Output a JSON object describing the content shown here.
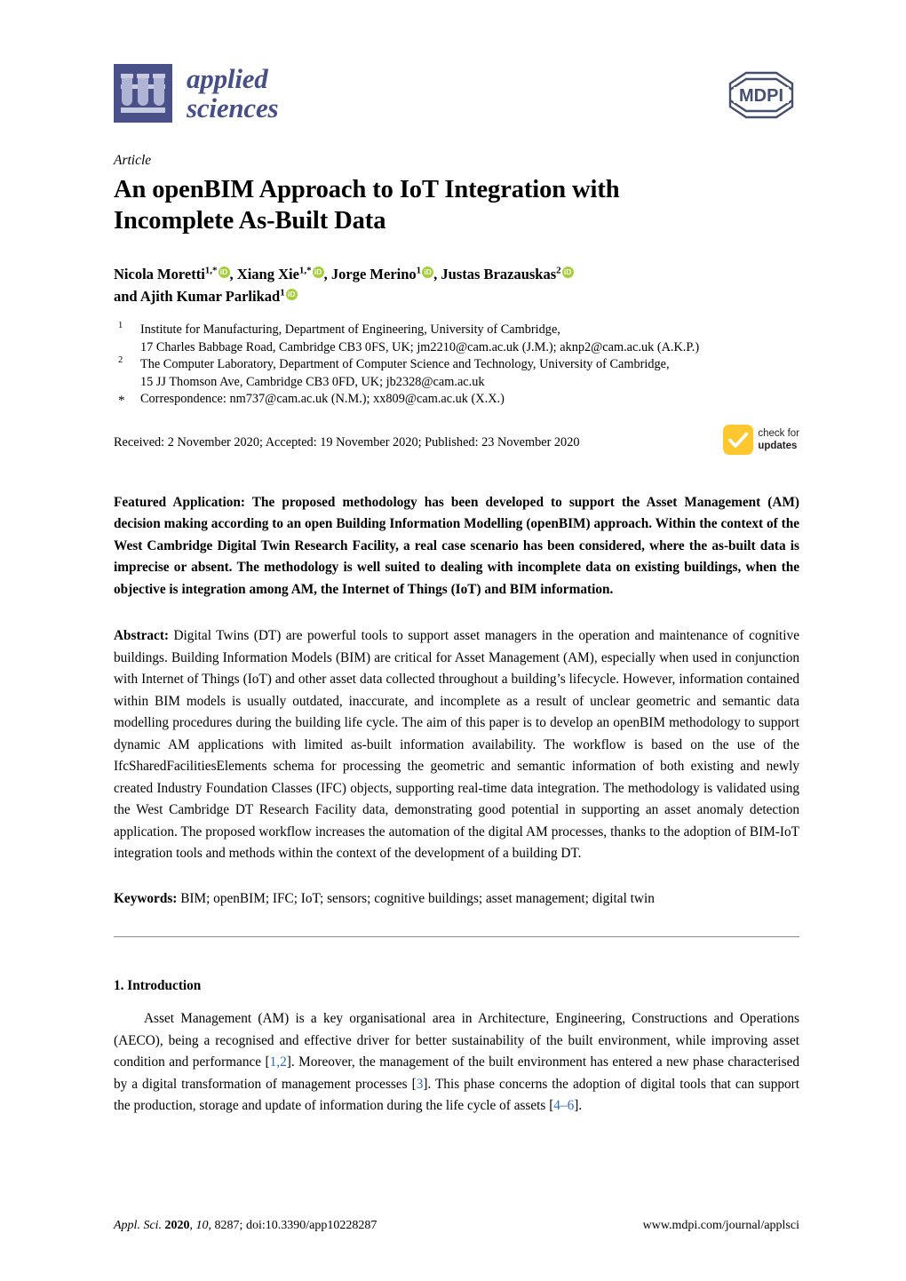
{
  "journal": {
    "name_line1": "applied",
    "name_line2": "sciences",
    "publisher_logo_text": "MDPI",
    "logo_icon": "test-tube-rack-icon",
    "brand_color": "#474f88"
  },
  "article_type": "Article",
  "title_lines": [
    "An openBIM Approach to IoT Integration with",
    "Incomplete As-Built Data"
  ],
  "authors": {
    "line1": [
      {
        "name": "Nicola Moretti",
        "sup": "1,*",
        "orcid": "iD"
      },
      {
        "name": "Xiang Xie",
        "sup": "1,*",
        "orcid": "iD"
      },
      {
        "name": "Jorge Merino",
        "sup": "1",
        "orcid": "iD"
      },
      {
        "name": "Justas Brazauskas",
        "sup": "2",
        "orcid": "iD"
      }
    ],
    "line2_prefix": "and",
    "line2": [
      {
        "name": "Ajith Kumar Parlikad",
        "sup": "1",
        "orcid": "iD"
      }
    ]
  },
  "affiliations": [
    {
      "marker": "1",
      "lines": [
        "Institute for Manufacturing, Department of Engineering, University of Cambridge,",
        "17 Charles Babbage Road, Cambridge CB3 0FS, UK; jm2210@cam.ac.uk (J.M.); aknp2@cam.ac.uk (A.K.P.)"
      ]
    },
    {
      "marker": "2",
      "lines": [
        "The Computer Laboratory, Department of Computer Science and Technology, University of Cambridge,",
        "15 JJ Thomson Ave, Cambridge CB3 0FD, UK; jb2328@cam.ac.uk"
      ]
    },
    {
      "marker": "*",
      "lines": [
        "Correspondence: nm737@cam.ac.uk (N.M.); xx809@cam.ac.uk (X.X.)"
      ]
    }
  ],
  "dates_line": "Received: 2 November 2020; Accepted: 19 November 2020; Published: 23 November 2020",
  "crossmark": {
    "line1": "check for",
    "line2": "updates",
    "icon": "checkmark-icon",
    "color": "#fdc82f"
  },
  "featured_application": {
    "lead": "Featured Application:",
    "text": " The proposed methodology has been developed to support the Asset Management (AM) decision making according to an open Building Information Modelling (openBIM) approach. Within the context of the West Cambridge Digital Twin Research Facility, a real case scenario has been considered, where the as-built data is imprecise or absent. The methodology is well suited to dealing with incomplete data on existing buildings, when the objective is integration among AM, the Internet of Things (IoT) and BIM information."
  },
  "abstract": {
    "lead": "Abstract:",
    "text": " Digital Twins (DT) are powerful tools to support asset managers in the operation and maintenance of cognitive buildings. Building Information Models (BIM) are critical for Asset Management (AM), especially when used in conjunction with Internet of Things (IoT) and other asset data collected throughout a building’s lifecycle. However, information contained within BIM models is usually outdated, inaccurate, and incomplete as a result of unclear geometric and semantic data modelling procedures during the building life cycle. The aim of this paper is to develop an openBIM methodology to support dynamic AM applications with limited as-built information availability. The workflow is based on the use of the IfcSharedFacilitiesElements schema for processing the geometric and semantic information of both existing and newly created Industry Foundation Classes (IFC) objects, supporting real-time data integration. The methodology is validated using the West Cambridge DT Research Facility data, demonstrating good potential in supporting an asset anomaly detection application. The proposed workflow increases the automation of the digital AM processes, thanks to the adoption of BIM-IoT integration tools and methods within the context of the development of a building DT."
  },
  "keywords": {
    "lead": "Keywords:",
    "text": " BIM; openBIM; IFC; IoT; sensors; cognitive buildings; asset management; digital twin"
  },
  "introduction": {
    "heading": "1. Introduction",
    "paragraph_part1": "Asset Management (AM) is a key organisational area in Architecture, Engineering, Constructions and Operations (AECO), being a recognised and effective driver for better sustainability of the built environment, while improving asset condition and performance [",
    "cite1": "1,2",
    "paragraph_part2": "]. Moreover, the management of the built environment has entered a new phase characterised by a digital transformation of management processes [",
    "cite2": "3",
    "paragraph_part3": "]. This phase concerns the adoption of digital tools that can support the production, storage and update of information during the life cycle of assets [",
    "cite3": "4–6",
    "paragraph_part4": "]."
  },
  "footer": {
    "journal_abbrev": "Appl. Sci.",
    "year": "2020",
    "volume": "10",
    "article_number": "8287",
    "doi": "doi:10.3390/app10228287",
    "url": "www.mdpi.com/journal/applsci"
  }
}
